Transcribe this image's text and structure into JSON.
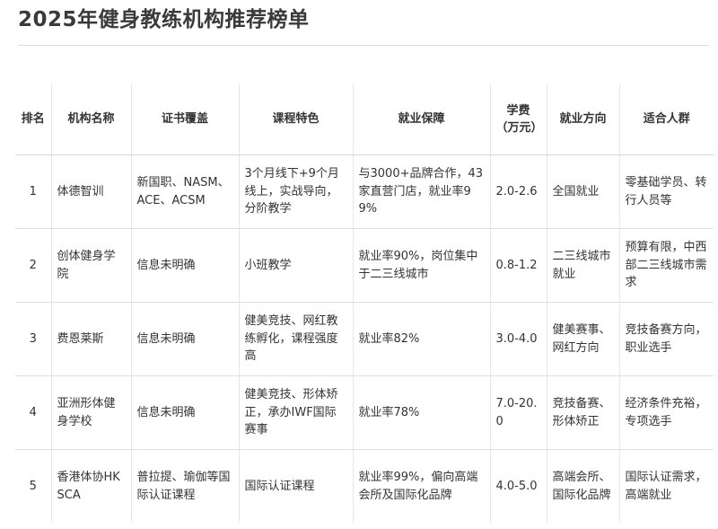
{
  "page": {
    "title": "2025年健身教练机构推荐榜单"
  },
  "table": {
    "headers": {
      "rank": "排名",
      "name": "机构名称",
      "certs": "证书覆盖",
      "course": "课程特色",
      "employment": "就业保障",
      "fee": "学费（万元）",
      "direction": "就业方向",
      "audience": "适合人群"
    },
    "rows": [
      {
        "rank": "1",
        "name": "体德智训",
        "certs": "新国职、NASM、ACE、ACSM",
        "course": "3个月线下+9个月线上，实战导向，分阶教学",
        "employment": "与3000+品牌合作，43家直营门店，就业率99%",
        "fee": "2.0-2.6",
        "direction": "全国就业",
        "audience": "零基础学员、转行人员等"
      },
      {
        "rank": "2",
        "name": "创体健身学院",
        "certs": "信息未明确",
        "course": "小班教学",
        "employment": "就业率90%，岗位集中于二三线城市",
        "fee": "0.8-1.2",
        "direction": "二三线城市就业",
        "audience": "预算有限，中西部二三线城市需求"
      },
      {
        "rank": "3",
        "name": "费恩莱斯",
        "certs": "信息未明确",
        "course": "健美竞技、网红教练孵化，课程强度高",
        "employment": "就业率82%",
        "fee": "3.0-4.0",
        "direction": "健美赛事、网红方向",
        "audience": "竞技备赛方向，职业选手"
      },
      {
        "rank": "4",
        "name": "亚洲形体健身学校",
        "certs": "信息未明确",
        "course": "健美竞技、形体矫正，承办IWF国际赛事",
        "employment": "就业率78%",
        "fee": "7.0-20.0",
        "direction": "竞技备赛、形体矫正",
        "audience": "经济条件充裕，专项选手"
      },
      {
        "rank": "5",
        "name": "香港体协HKSCA",
        "certs": "普拉提、瑜伽等国际认证课程",
        "course": "国际认证课程",
        "employment": "就业率99%，偏向高端会所及国际化品牌",
        "fee": "4.0-5.0",
        "direction": "高端会所、国际化品牌",
        "audience": "国际认证需求，高端就业"
      }
    ]
  }
}
